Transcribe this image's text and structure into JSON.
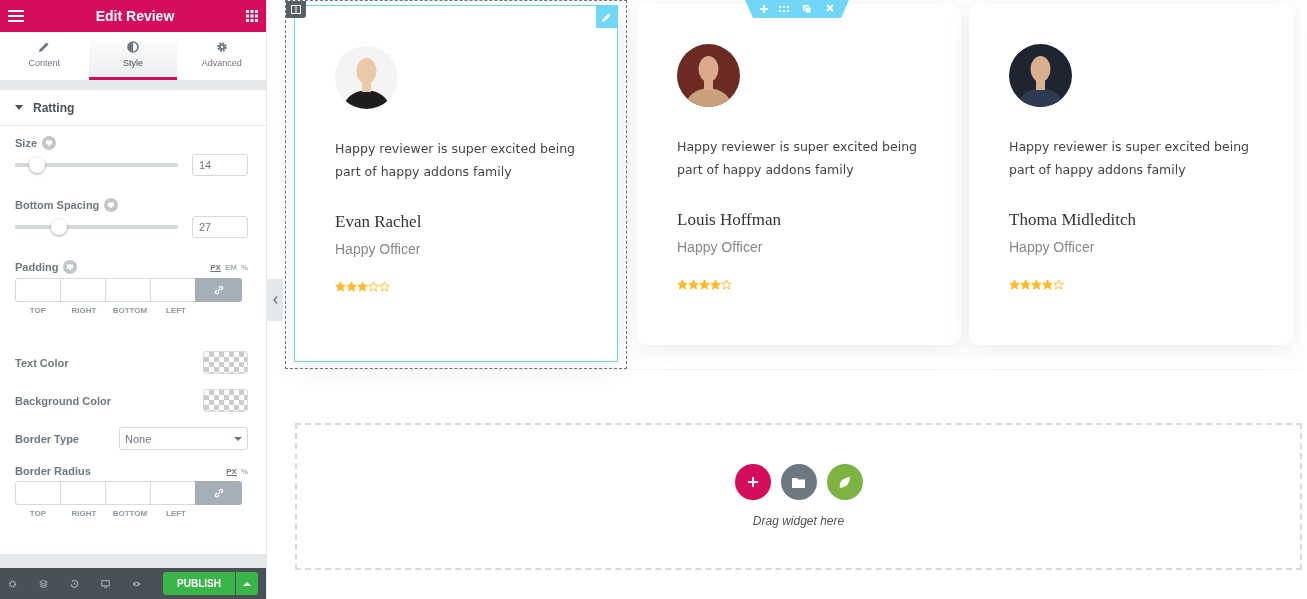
{
  "panel": {
    "title": "Edit Review"
  },
  "tabs": [
    {
      "label": "Content",
      "kind": "pencil",
      "selected": false
    },
    {
      "label": "Style",
      "kind": "contrast",
      "selected": true
    },
    {
      "label": "Advanced",
      "kind": "gear",
      "selected": false
    }
  ],
  "section": {
    "title": "Ratting",
    "expanded": true
  },
  "controls": [
    {
      "kind": "slider",
      "label": "Size",
      "responsive": true,
      "level": 0.135,
      "value": "14"
    },
    {
      "kind": "slider",
      "label": "Bottom Spacing",
      "responsive": true,
      "level": 0.27,
      "value": "27"
    },
    {
      "kind": "dimensions",
      "label": "Padding",
      "responsive": true,
      "units": [
        {
          "label": "PX",
          "selected": true
        },
        {
          "label": "EM",
          "selected": false
        },
        {
          "label": "%",
          "selected": false
        }
      ],
      "sides": [
        "TOP",
        "RIGHT",
        "BOTTOM",
        "LEFT"
      ]
    },
    {
      "kind": "color",
      "label": "Text Color"
    },
    {
      "kind": "color",
      "label": "Background Color"
    },
    {
      "kind": "select",
      "label": "Border Type",
      "value": "None"
    },
    {
      "kind": "dimensions",
      "label": "Border Radius",
      "responsive": false,
      "units": [
        {
          "label": "PX",
          "selected": true
        },
        {
          "label": "%",
          "selected": false
        }
      ],
      "sides": [
        "TOP",
        "RIGHT",
        "BOTTOM",
        "LEFT"
      ]
    }
  ],
  "footer": {
    "publish": "PUBLISH"
  },
  "reviews": [
    {
      "text": "Happy reviewer is super excited being part of happy addons family",
      "name": "Evan Rachel",
      "role": "Happy Officer",
      "stars": 3,
      "selected": true
    },
    {
      "text": "Happy reviewer is super excited being part of happy addons family",
      "name": "Louis Hoffman",
      "role": "Happy Officer",
      "stars": 4,
      "selected": false
    },
    {
      "text": "Happy reviewer is super excited being part of happy addons family",
      "name": "Thoma Midleditch",
      "role": "Happy Officer",
      "stars": 4,
      "selected": false
    }
  ],
  "drop_zone": {
    "hint": "Drag widget here"
  }
}
